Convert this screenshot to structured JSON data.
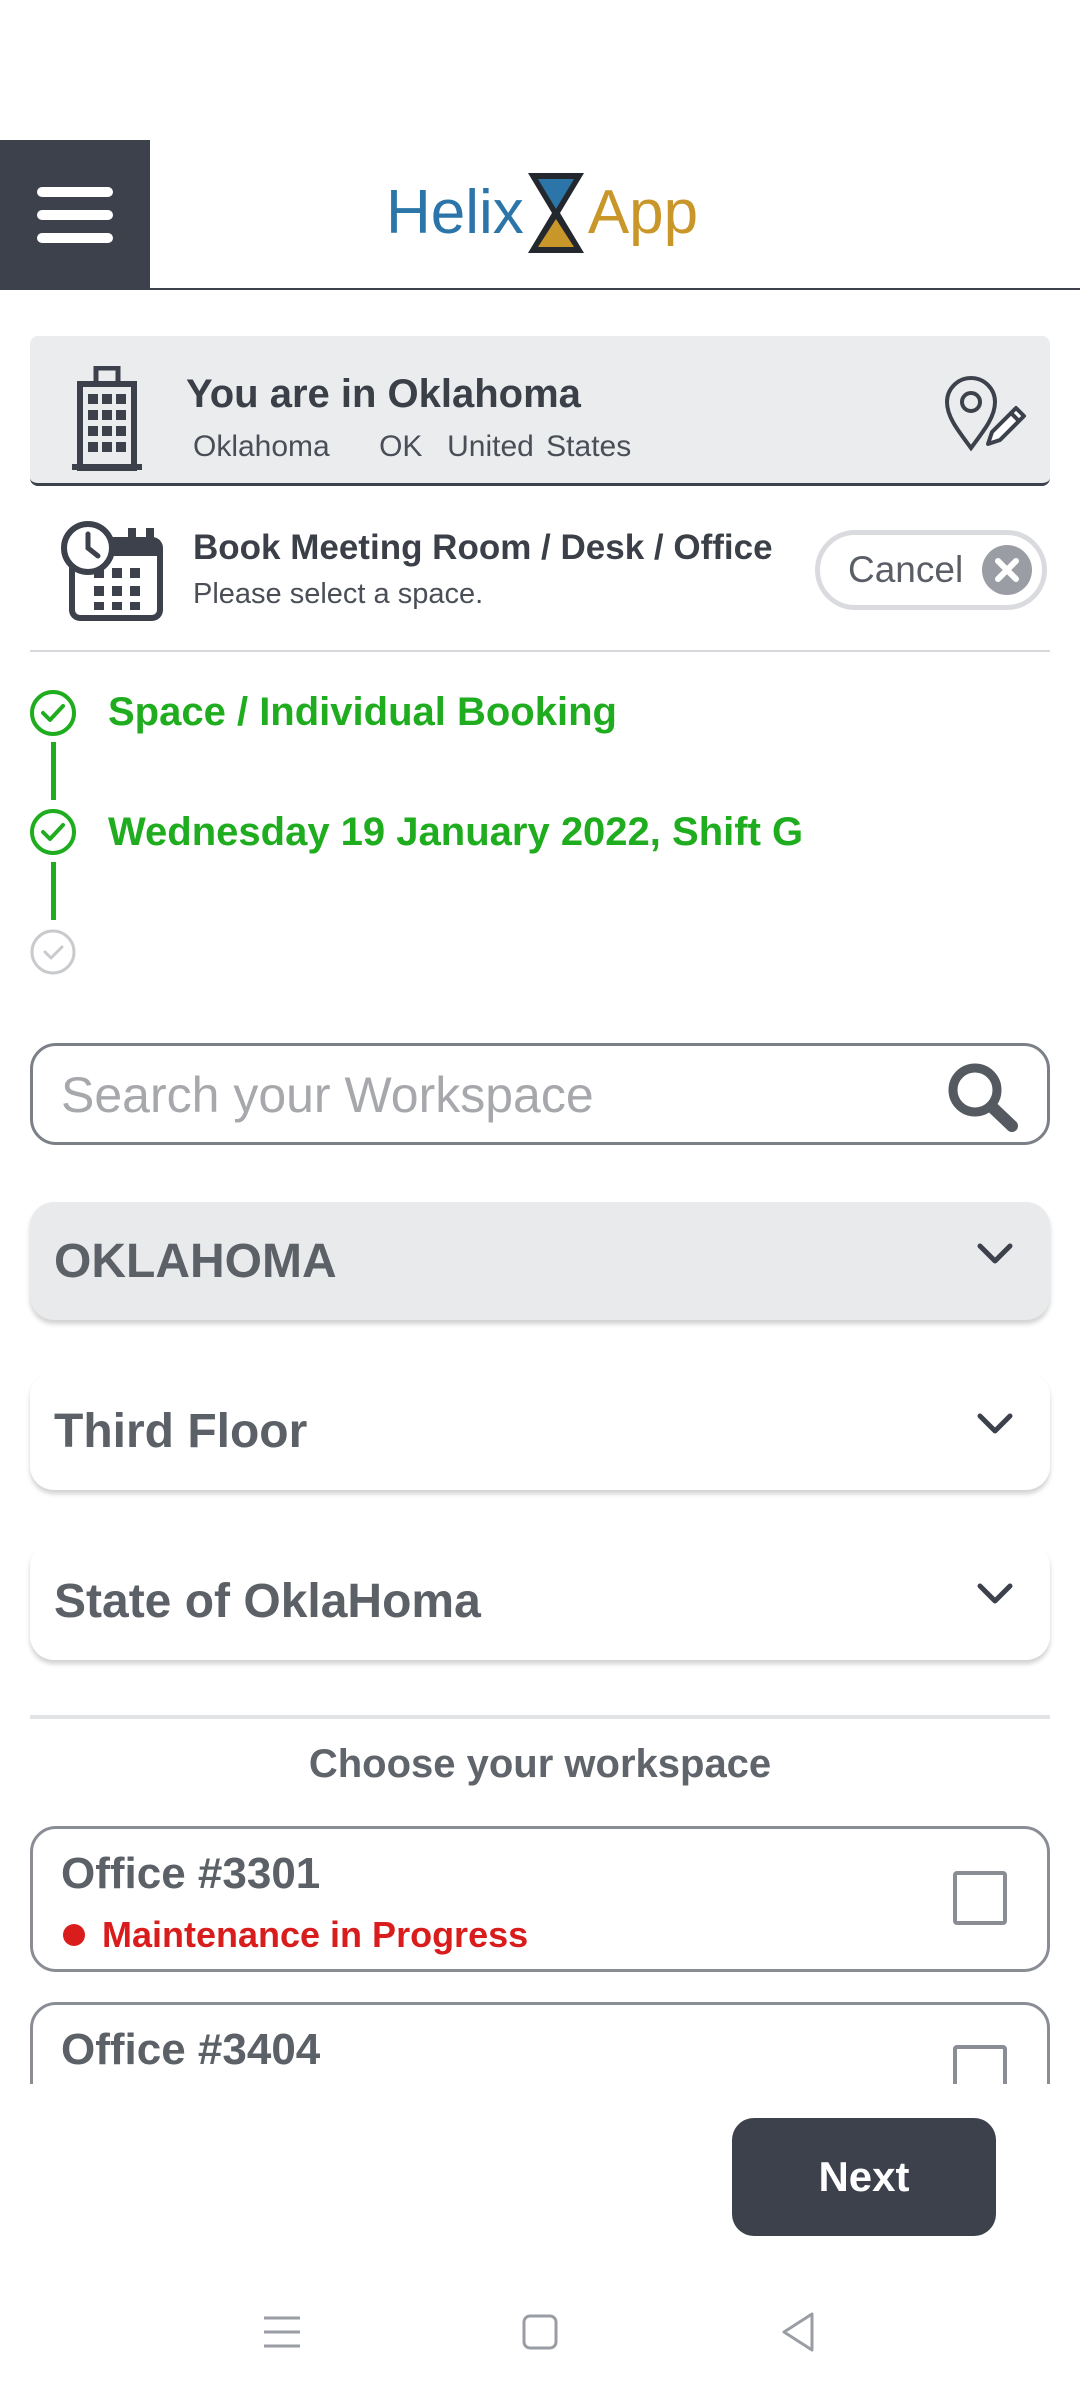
{
  "header": {
    "logo_left": "Helix",
    "logo_right": "App",
    "menu_icon": "hamburger-menu-icon",
    "accent_color": "#3c414c"
  },
  "location": {
    "title": "You are in Oklahoma",
    "city": "Oklahoma",
    "state": "OK",
    "country": "United States",
    "building_icon": "building-icon",
    "edit_icon": "map-pin-edit-icon"
  },
  "booking": {
    "title": "Book Meeting Room / Desk / Office",
    "subtitle": "Please select a space.",
    "cancel_label": "Cancel",
    "calendar_icon": "calendar-clock-icon"
  },
  "steps": [
    {
      "label": "Space / Individual Booking",
      "status": "done"
    },
    {
      "label": "Wednesday 19 January 2022, Shift G",
      "status": "done"
    },
    {
      "label": "",
      "status": "pending"
    }
  ],
  "search": {
    "placeholder": "Search your Workspace",
    "value": ""
  },
  "filters": {
    "location": "OKLAHOMA",
    "floor": "Third Floor",
    "area": "State of OklaHoma"
  },
  "workspaces": {
    "heading": "Choose your workspace",
    "items": [
      {
        "name": "Office #3301",
        "status": "Maintenance in Progress",
        "checked": false
      },
      {
        "name": "Office #3404",
        "status": "",
        "checked": false
      }
    ]
  },
  "actions": {
    "next_label": "Next"
  },
  "colors": {
    "step_done": "#1fad1f",
    "maintenance": "#d91c1c"
  }
}
